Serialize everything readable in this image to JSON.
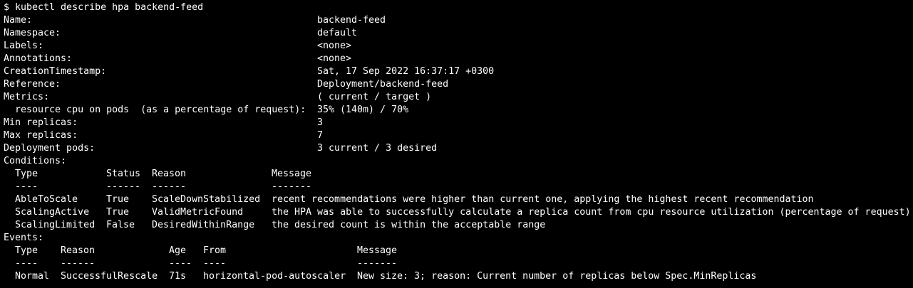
{
  "terminal": {
    "prompt": "$ kubectl describe hpa backend-feed",
    "fields": {
      "name_label": "Name:",
      "name_value": "backend-feed",
      "namespace_label": "Namespace:",
      "namespace_value": "default",
      "labels_label": "Labels:",
      "labels_value": "<none>",
      "annotations_label": "Annotations:",
      "annotations_value": "<none>",
      "creation_label": "CreationTimestamp:",
      "creation_value": "Sat, 17 Sep 2022 16:37:17 +0300",
      "reference_label": "Reference:",
      "reference_value": "Deployment/backend-feed",
      "metrics_label": "Metrics:",
      "metrics_value": "( current / target )",
      "metric_label": "  resource cpu on pods  (as a percentage of request):",
      "metric_value": "35% (140m) / 70%",
      "min_label": "Min replicas:",
      "min_value": "3",
      "max_label": "Max replicas:",
      "max_value": "7",
      "pods_label": "Deployment pods:",
      "pods_value": "3 current / 3 desired"
    },
    "conditions": {
      "header": "Conditions:",
      "columns": [
        "Type",
        "Status",
        "Reason",
        "Message"
      ],
      "dashes": [
        "----",
        "------",
        "------",
        "-------"
      ],
      "rows": [
        [
          "AbleToScale",
          "True",
          "ScaleDownStabilized",
          "recent recommendations were higher than current one, applying the highest recent recommendation"
        ],
        [
          "ScalingActive",
          "True",
          "ValidMetricFound",
          "the HPA was able to successfully calculate a replica count from cpu resource utilization (percentage of request)"
        ],
        [
          "ScalingLimited",
          "False",
          "DesiredWithinRange",
          "the desired count is within the acceptable range"
        ]
      ]
    },
    "events": {
      "header": "Events:",
      "columns": [
        "Type",
        "Reason",
        "Age",
        "From",
        "Message"
      ],
      "dashes": [
        "----",
        "------",
        "----",
        "----",
        "-------"
      ],
      "rows": [
        [
          "Normal",
          "SuccessfulRescale",
          "71s",
          "horizontal-pod-autoscaler",
          "New size: 3; reason: Current number of replicas below Spec.MinReplicas"
        ]
      ]
    },
    "colors": {
      "background": "#000000",
      "text": "#ffffff"
    }
  }
}
